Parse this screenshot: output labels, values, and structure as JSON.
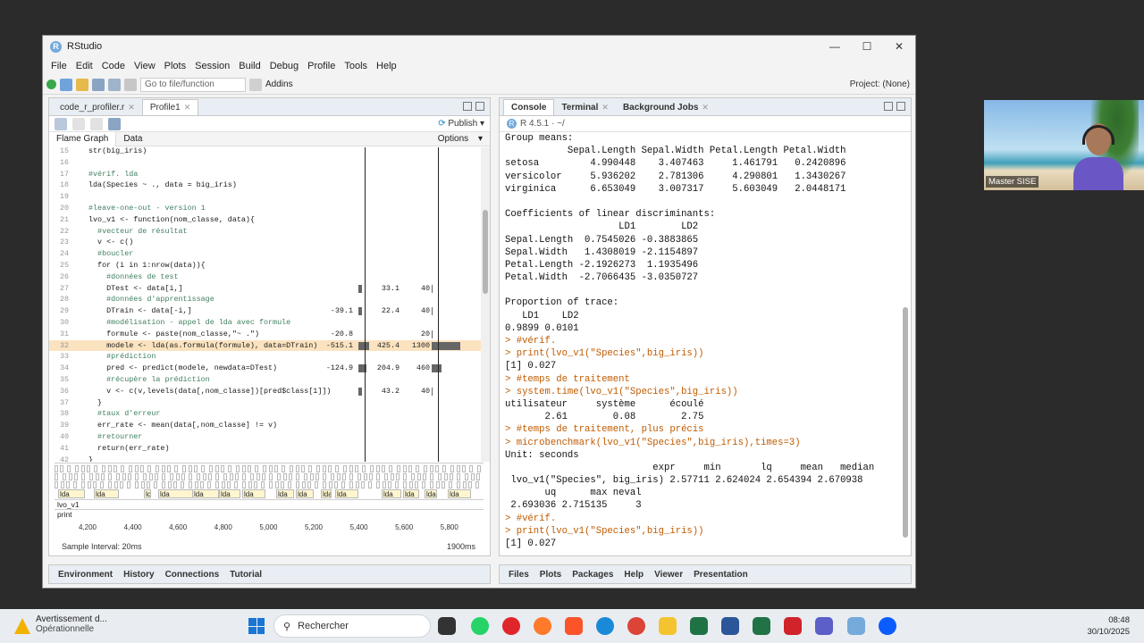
{
  "window": {
    "title": "RStudio",
    "controls": [
      "—",
      "☐",
      "✕"
    ]
  },
  "menu": [
    "File",
    "Edit",
    "Code",
    "View",
    "Plots",
    "Session",
    "Build",
    "Debug",
    "Profile",
    "Tools",
    "Help"
  ],
  "toolbar": {
    "goto_placeholder": "Go to file/function",
    "addins": "Addins",
    "project": "Project: (None)"
  },
  "left_tabs": [
    {
      "label": "code_r_profiler.r",
      "active": false
    },
    {
      "label": "Profile1",
      "active": true
    }
  ],
  "publish": "Publish",
  "profile_tabs": {
    "flame": "Flame Graph",
    "data": "Data",
    "options": "Options"
  },
  "code_lines": [
    {
      "n": "15",
      "t": "str(big_iris)",
      "c": false
    },
    {
      "n": "16",
      "t": "",
      "c": false
    },
    {
      "n": "17",
      "t": "#vérif. lda",
      "c": true
    },
    {
      "n": "18",
      "t": "lda(Species ~ ., data = big_iris)",
      "c": false
    },
    {
      "n": "19",
      "t": "",
      "c": false
    },
    {
      "n": "20",
      "t": "#leave-one-out - version 1",
      "c": true
    },
    {
      "n": "21",
      "t": "lvo_v1 <- function(nom_classe, data){",
      "c": false
    },
    {
      "n": "22",
      "t": "  #vecteur de résultat",
      "c": true
    },
    {
      "n": "23",
      "t": "  v <- c()",
      "c": false
    },
    {
      "n": "24",
      "t": "  #boucler",
      "c": true
    },
    {
      "n": "25",
      "t": "  for (i in 1:nrow(data)){",
      "c": false
    },
    {
      "n": "26",
      "t": "    #données de test",
      "c": true
    },
    {
      "n": "27",
      "t": "    DTest <- data[i,]",
      "c": false,
      "time": "33.1",
      "pct": "40",
      "b1": 4,
      "b2": 1
    },
    {
      "n": "28",
      "t": "    #données d'apprentissage",
      "c": true
    },
    {
      "n": "29",
      "t": "    DTrain <- data[-i,]",
      "c": false,
      "mem": "-39.1",
      "time": "22.4",
      "pct": "40",
      "b1": 4,
      "b2": 1
    },
    {
      "n": "30",
      "t": "    #modélisation - appel de lda avec formule",
      "c": true
    },
    {
      "n": "31",
      "t": "    formule <- paste(nom_classe,\"~ .\")",
      "c": false,
      "mem": "-20.8",
      "pct": "20",
      "b2": 1
    },
    {
      "n": "32",
      "t": "    modele <- lda(as.formula(formule), data=DTrain)",
      "c": false,
      "hl": true,
      "mem": "-515.1",
      "time": "425.4",
      "pct": "1300",
      "b1": 12,
      "b2": 32
    },
    {
      "n": "33",
      "t": "    #prédiction",
      "c": true
    },
    {
      "n": "34",
      "t": "    pred <- predict(modele, newdata=DTest)",
      "c": false,
      "mem": "-124.9",
      "time": "204.9",
      "pct": "460",
      "b1": 9,
      "b2": 11
    },
    {
      "n": "35",
      "t": "    #récupère la prédiction",
      "c": true
    },
    {
      "n": "36",
      "t": "    v <- c(v,levels(data[,nom_classe])[pred$class[1]])",
      "c": false,
      "time": "43.2",
      "pct": "40",
      "b1": 4,
      "b2": 1
    },
    {
      "n": "37",
      "t": "  }",
      "c": false
    },
    {
      "n": "38",
      "t": "  #taux d'erreur",
      "c": true
    },
    {
      "n": "39",
      "t": "  err_rate <- mean(data[,nom_classe] != v)",
      "c": false
    },
    {
      "n": "40",
      "t": "  #retourner",
      "c": true
    },
    {
      "n": "41",
      "t": "  return(err_rate)",
      "c": false
    },
    {
      "n": "42",
      "t": "}",
      "c": false
    }
  ],
  "flame": {
    "lda_label": "lda",
    "stack_labels": [
      "lvo_v1",
      "print"
    ],
    "axis_ticks": [
      "4,200",
      "4,400",
      "4,600",
      "4,800",
      "5,000",
      "5,200",
      "5,400",
      "5,600",
      "5,800"
    ],
    "sample_interval": "Sample Interval: 20ms",
    "total": "1900ms"
  },
  "left_bottom_tabs": [
    "Environment",
    "History",
    "Connections",
    "Tutorial"
  ],
  "right_tabs": [
    "Console",
    "Terminal",
    "Background Jobs"
  ],
  "r_version": "R 4.5.1 · ~/",
  "console_lines": [
    {
      "t": "Group means:",
      "in": false
    },
    {
      "t": "           Sepal.Length Sepal.Width Petal.Length Petal.Width",
      "in": false
    },
    {
      "t": "setosa         4.990448    3.407463     1.461791   0.2420896",
      "in": false
    },
    {
      "t": "versicolor     5.936202    2.781306     4.290801   1.3430267",
      "in": false
    },
    {
      "t": "virginica      6.653049    3.007317     5.603049   2.0448171",
      "in": false
    },
    {
      "t": "",
      "in": false
    },
    {
      "t": "Coefficients of linear discriminants:",
      "in": false
    },
    {
      "t": "                    LD1        LD2",
      "in": false
    },
    {
      "t": "Sepal.Length  0.7545026 -0.3883865",
      "in": false
    },
    {
      "t": "Sepal.Width   1.4308019 -2.1154897",
      "in": false
    },
    {
      "t": "Petal.Length -2.1926273  1.1935496",
      "in": false
    },
    {
      "t": "Petal.Width  -2.7066435 -3.0350727",
      "in": false
    },
    {
      "t": "",
      "in": false
    },
    {
      "t": "Proportion of trace:",
      "in": false
    },
    {
      "t": "   LD1    LD2",
      "in": false
    },
    {
      "t": "0.9899 0.0101",
      "in": false
    },
    {
      "t": "> #vérif.",
      "in": true
    },
    {
      "t": "> print(lvo_v1(\"Species\",big_iris))",
      "in": true
    },
    {
      "t": "[1] 0.027",
      "in": false
    },
    {
      "t": "> #temps de traitement",
      "in": true
    },
    {
      "t": "> system.time(lvo_v1(\"Species\",big_iris))",
      "in": true
    },
    {
      "t": "utilisateur     système      écoulé",
      "in": false
    },
    {
      "t": "       2.61        0.08        2.75",
      "in": false
    },
    {
      "t": "> #temps de traitement, plus précis",
      "in": true
    },
    {
      "t": "> microbenchmark(lvo_v1(\"Species\",big_iris),times=3)",
      "in": true
    },
    {
      "t": "Unit: seconds",
      "in": false
    },
    {
      "t": "                          expr     min       lq     mean   median",
      "in": false
    },
    {
      "t": " lvo_v1(\"Species\", big_iris) 2.57711 2.624024 2.654394 2.670938",
      "in": false
    },
    {
      "t": "       uq      max neval",
      "in": false
    },
    {
      "t": " 2.693036 2.715135     3",
      "in": false
    },
    {
      "t": "> #vérif.",
      "in": true
    },
    {
      "t": "> print(lvo_v1(\"Species\",big_iris))",
      "in": true
    },
    {
      "t": "[1] 0.027",
      "in": false
    },
    {
      "t": "> ",
      "in": true
    }
  ],
  "right_bottom_tabs": [
    "Files",
    "Plots",
    "Packages",
    "Help",
    "Viewer",
    "Presentation"
  ],
  "webcam": {
    "name": "Master SISE"
  },
  "taskbar": {
    "notif_title": "Avertissement d...",
    "notif_sub": "Opérationnelle",
    "search_placeholder": "Rechercher",
    "time": "08:48",
    "date": "30/10/2025"
  }
}
